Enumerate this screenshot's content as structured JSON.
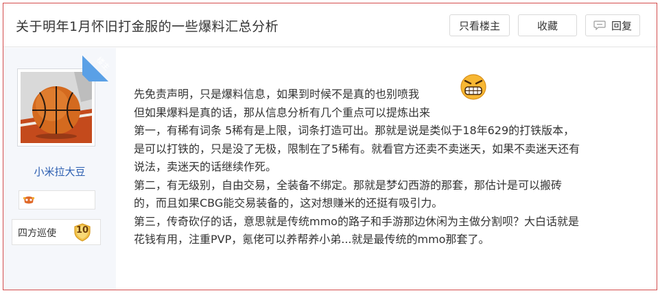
{
  "thread": {
    "title": "关于明年1月怀旧打金服的一些爆料汇总分析"
  },
  "toolbar": {
    "only_op_label": "只看楼主",
    "favorite_label": "收藏",
    "reply_label": "回复",
    "reply_icon": "speech-bubble-icon"
  },
  "author": {
    "badge_label": "楼主",
    "name": "小米拉大豆",
    "avatar_icon": "basketball-avatar",
    "rank_name": "四方巡使",
    "rank_level": "10",
    "medal_icon": "game-medal-icon"
  },
  "post": {
    "emoji_icon": "grimacing-face-icon",
    "lines": [
      "先免责声明，只是爆料信息，如果到时候不是真的也别喷我",
      "但如果爆料是真的话，那从信息分析有几个重点可以提炼出来",
      "第一，有稀有词条 5稀有是上限，词条打造可出。那就是说是类似于18年629的打铁版本，",
      "是可以打铁的，只是没了无极，限制在了5稀有。就看官方还卖不卖迷天，如果不卖迷天还有",
      "说法，卖迷天的话继续作死。",
      "第二，有无级别，自由交易，全装备不绑定。那就是梦幻西游的那套，那估计是可以搬砖",
      "的，而且如果CBG能交易装备的，这对想赚米的还挺有吸引力。",
      "第三，传奇砍仔的话，意思就是传统mmo的路子和手游那边休闲为主做分割呗？大白话就是",
      "花钱有用，注重PVP，氪佬可以养帮养小弟...就是最传统的mmo那套了。"
    ]
  },
  "colors": {
    "frame_border": "#d34b4b",
    "username": "#2a5db0",
    "ribbon": "#5aa0e6",
    "sidebar_bg": "#f5f7fb"
  }
}
